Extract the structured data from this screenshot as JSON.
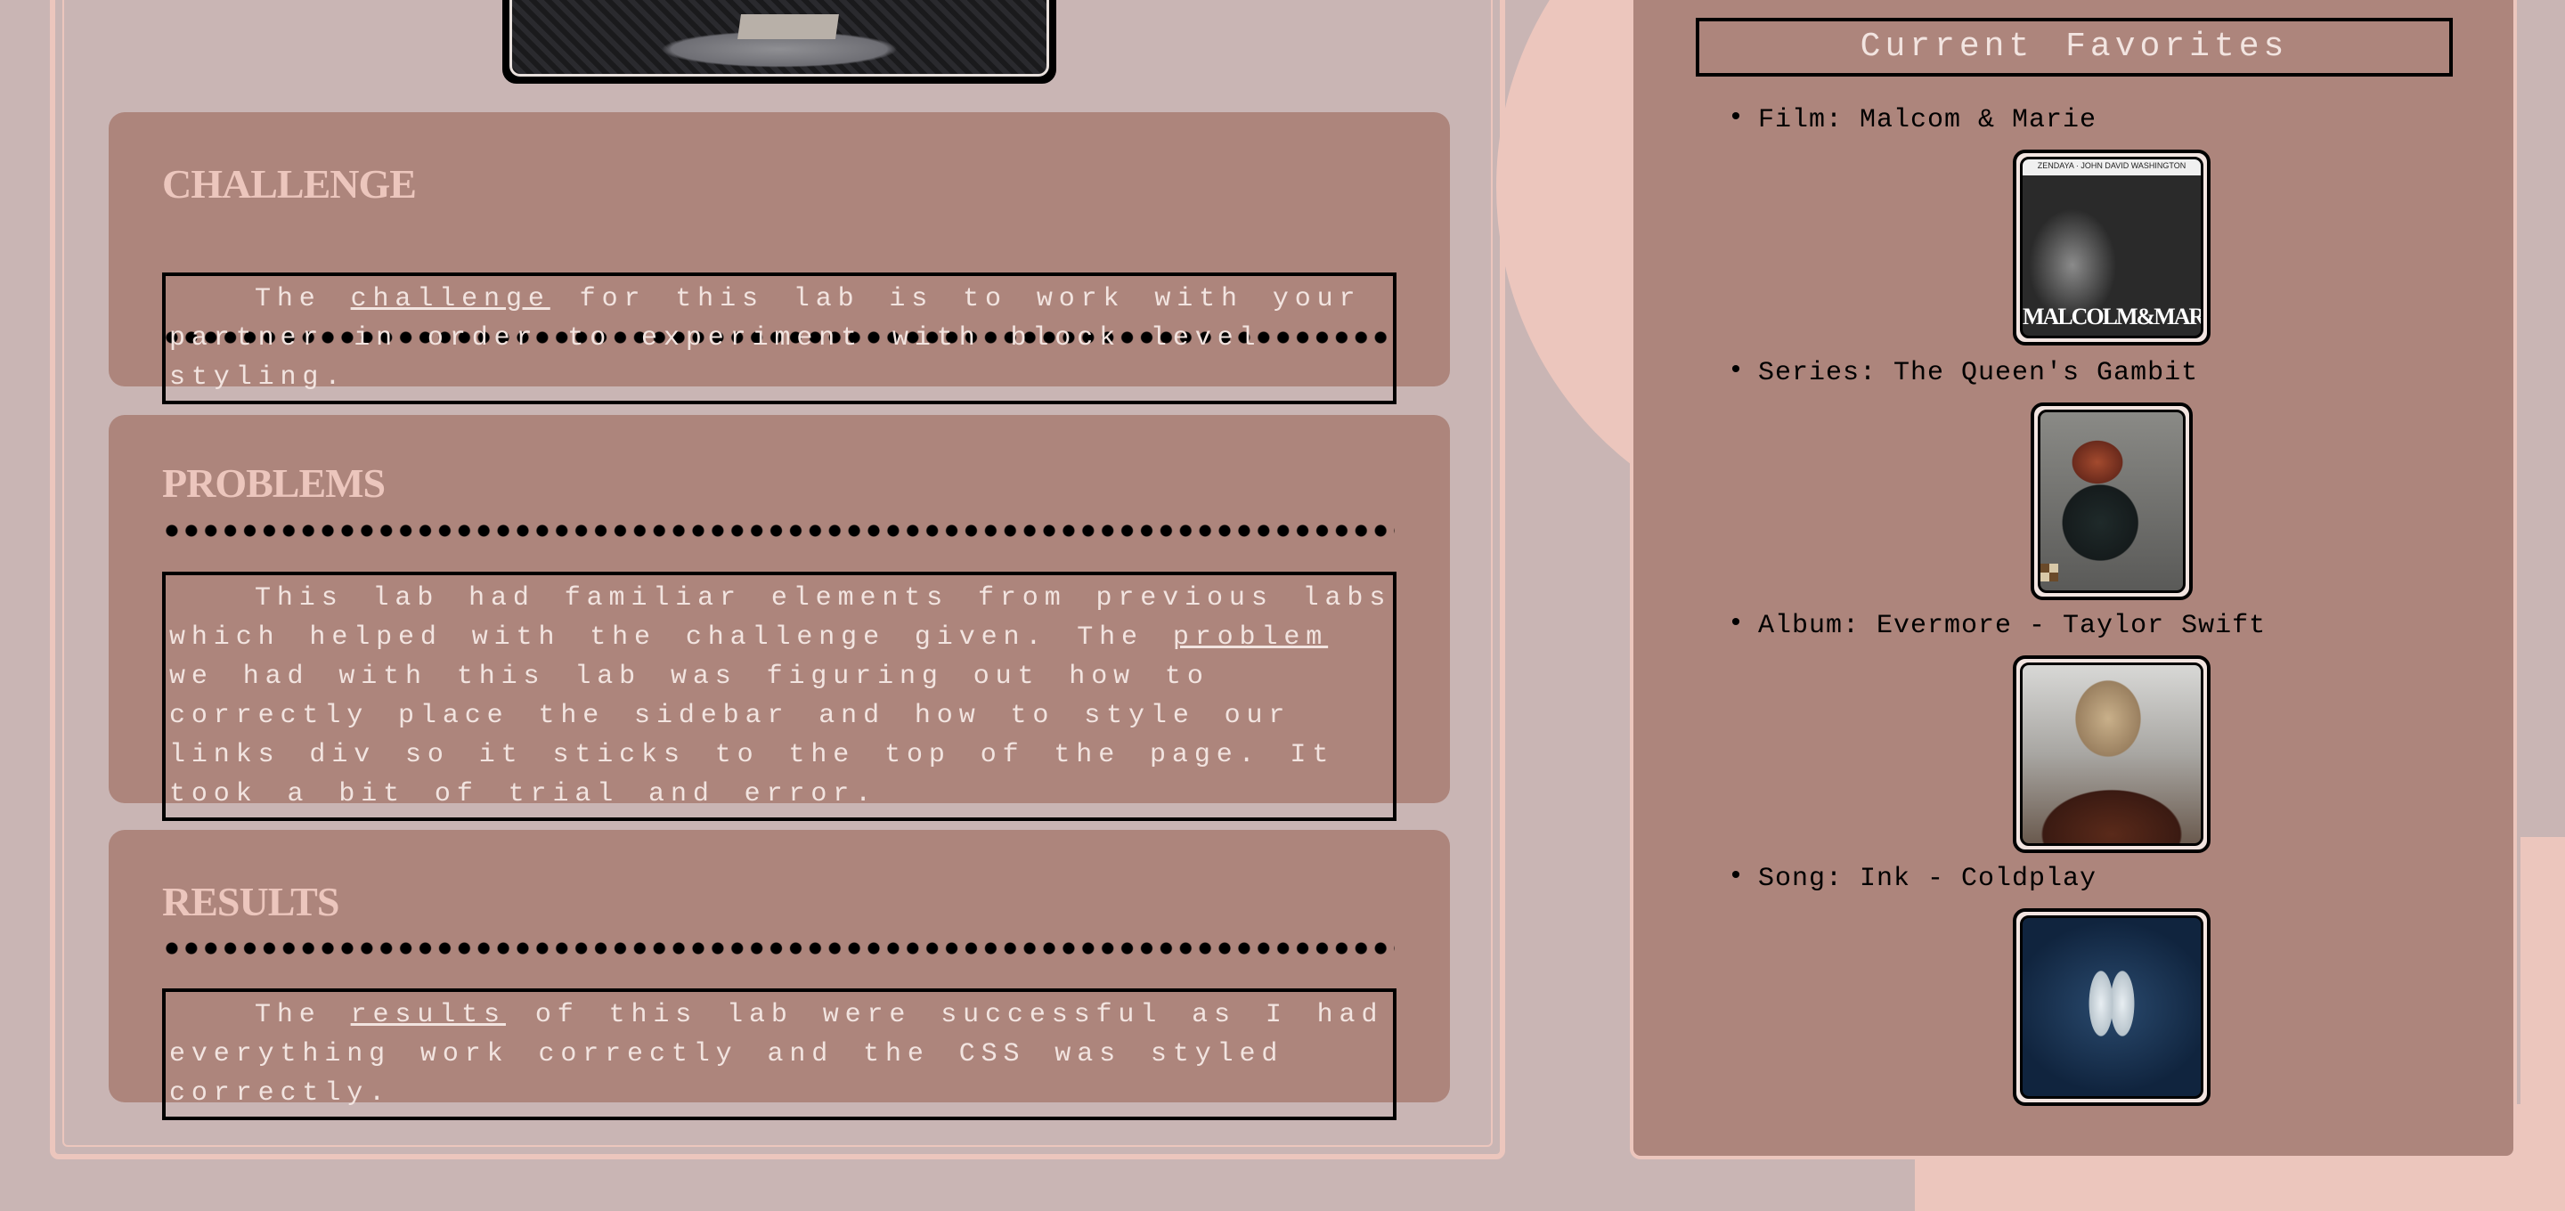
{
  "theme": {
    "background": "#c9b5b4",
    "accent_pink": "#ecc6bd",
    "card_color": "#ad857c",
    "text_light": "#f2e4e0",
    "border_dark": "#000000"
  },
  "main": {
    "hero_image_icon": "cafe-table-photo",
    "sections": [
      {
        "heading": "CHALLENGE",
        "text_before": "The ",
        "link": "challenge",
        "text_after": " for this lab is to work with your partner in order to experiment with block level styling."
      },
      {
        "heading": "PROBLEMS",
        "text_before": "This lab had familiar elements from previous labs which helped with the challenge given. The ",
        "link": "problem",
        "text_after": " we had with this lab was figuring out how to correctly place the sidebar and how to style our links div so it sticks to the top of the page. It took a bit of trial and error."
      },
      {
        "heading": "RESULTS",
        "text_before": "The ",
        "link": "results",
        "text_after": " of this lab were successful as I had everything work correctly and the CSS was styled correctly."
      }
    ]
  },
  "sidebar": {
    "title": "Current Favorites",
    "items": [
      {
        "label": "Film: Malcom & Marie",
        "image_icon": "malcolm-marie-poster",
        "poster_top": "ZENDAYA · JOHN DAVID WASHINGTON",
        "poster_caption": "MALCOLM&MARIE"
      },
      {
        "label": "Series: The Queen's Gambit",
        "image_icon": "queens-gambit-still"
      },
      {
        "label": "Album: Evermore - Taylor Swift",
        "image_icon": "evermore-cover"
      },
      {
        "label": "Song: Ink - Coldplay",
        "image_icon": "ghost-stories-cover"
      }
    ]
  }
}
